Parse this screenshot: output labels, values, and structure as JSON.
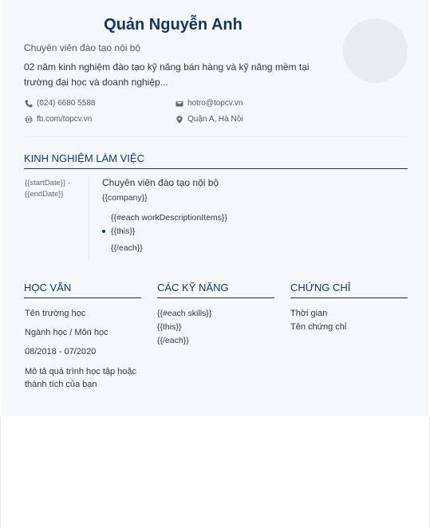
{
  "header": {
    "name": "Quản Nguyễn Anh",
    "position": "Chuyên viên đào tạo nội bộ",
    "summary": "02 năm kinh nghiệm đào tạo kỹ năng bán hàng và kỹ năng mềm tại trường đại học và doanh nghiệp..."
  },
  "contact": {
    "phone": "(024) 6680 5588",
    "email": "hotro@topcv.vn",
    "website": "fb.com/topcv.vn",
    "address": "Quận A, Hà Nội"
  },
  "experience": {
    "title": "KINH NGHIỆM LÀM VIỆC",
    "date_start": "{{startDate}} -",
    "date_end": "{{endDate}}",
    "job_title": "Chuyên viên đào tạo nội bộ",
    "company": "{{company}}",
    "each_open": "{{#each workDescriptionItems}}",
    "this": "{{this}}",
    "each_close": "{{/each}}"
  },
  "education": {
    "title": "HỌC VẤN",
    "school": "Tên trường học",
    "major": "Ngành học / Môn học",
    "period": "08/2018 - 07/2020",
    "description": "Mô tả quá trình học tập hoặc thành tích của bạn"
  },
  "skills": {
    "title": "CÁC KỸ NĂNG",
    "each_open": "{{#each skills}}",
    "this": "{{this}}",
    "each_close": "{{/each}}"
  },
  "certificates": {
    "title": "CHỨNG CHỈ",
    "time": "Thời gian",
    "name": "Tên chứng chỉ"
  },
  "colors": {
    "accent": "#13355f",
    "background": "#f5f8fc"
  },
  "icons": [
    "phone-icon",
    "email-icon",
    "globe-icon",
    "location-icon"
  ]
}
